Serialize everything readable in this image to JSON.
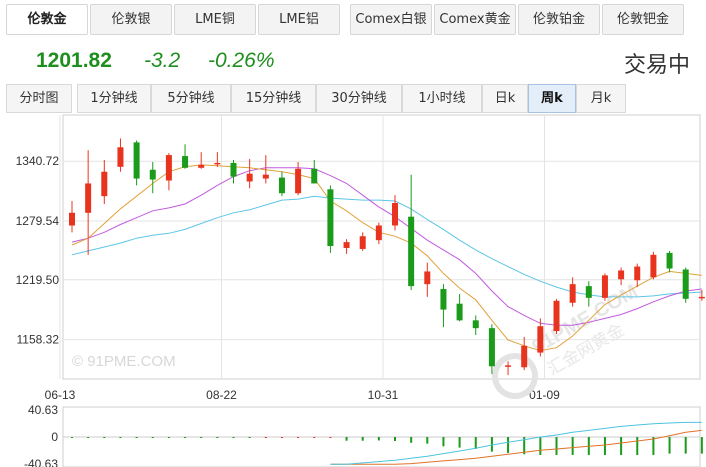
{
  "tabs": [
    {
      "label": "伦敦金",
      "active": true
    },
    {
      "label": "伦敦银",
      "active": false
    },
    {
      "label": "LME铜",
      "active": false
    },
    {
      "label": "LME铝",
      "active": false
    },
    {
      "label": "Comex白银",
      "active": false
    },
    {
      "label": "Comex黄金",
      "active": false
    },
    {
      "label": "伦敦铂金",
      "active": false
    },
    {
      "label": "伦敦钯金",
      "active": false
    }
  ],
  "quote": {
    "price": "1201.82",
    "change": "-3.2",
    "change_pct": "-0.26%",
    "status": "交易中",
    "color": "#1e8f1e"
  },
  "periods": [
    {
      "label": "分时图",
      "active": false
    },
    {
      "label": "1分钟线",
      "active": false
    },
    {
      "label": "5分钟线",
      "active": false
    },
    {
      "label": "15分钟线",
      "active": false
    },
    {
      "label": "30分钟线",
      "active": false
    },
    {
      "label": "1小时线",
      "active": false
    },
    {
      "label": "日k",
      "active": false
    },
    {
      "label": "周k",
      "active": true
    },
    {
      "label": "月k",
      "active": false
    }
  ],
  "watermarks": {
    "left": "© 91PME.COM",
    "right_line1": "91PME.COM",
    "right_line2": "汇金网黄金"
  },
  "colors": {
    "up": "#e8341f",
    "down": "#1a9b1a",
    "ma_short": "#e0a23a",
    "ma_mid": "#c35ae0",
    "ma_long": "#5cc6e6",
    "grid": "#e4e4e4"
  },
  "chart_data": [
    {
      "type": "candlestick",
      "title": "",
      "y_ticks": [
        "1340.72",
        "1279.54",
        "1219.50",
        "1158.32"
      ],
      "y_tick_values": [
        1340.72,
        1279.54,
        1219.5,
        1158.32
      ],
      "ylim": [
        1118,
        1388
      ],
      "x_ticks": [
        "06-13",
        "08-22",
        "10-31",
        "01-09"
      ],
      "x_tick_index": [
        0,
        10,
        20,
        30
      ],
      "grid": true,
      "candles": [
        {
          "o": 1275,
          "h": 1300,
          "l": 1268,
          "c": 1288
        },
        {
          "o": 1288,
          "h": 1352,
          "l": 1245,
          "c": 1318
        },
        {
          "o": 1305,
          "h": 1342,
          "l": 1297,
          "c": 1330
        },
        {
          "o": 1335,
          "h": 1364,
          "l": 1330,
          "c": 1355
        },
        {
          "o": 1360,
          "h": 1362,
          "l": 1316,
          "c": 1323
        },
        {
          "o": 1332,
          "h": 1340,
          "l": 1308,
          "c": 1322
        },
        {
          "o": 1321,
          "h": 1349,
          "l": 1311,
          "c": 1347
        },
        {
          "o": 1346,
          "h": 1358,
          "l": 1333,
          "c": 1334
        },
        {
          "o": 1334,
          "h": 1350,
          "l": 1333,
          "c": 1337
        },
        {
          "o": 1338,
          "h": 1350,
          "l": 1335,
          "c": 1339
        },
        {
          "o": 1339,
          "h": 1342,
          "l": 1318,
          "c": 1325
        },
        {
          "o": 1320,
          "h": 1343,
          "l": 1313,
          "c": 1328
        },
        {
          "o": 1323,
          "h": 1347,
          "l": 1318,
          "c": 1327
        },
        {
          "o": 1324,
          "h": 1330,
          "l": 1305,
          "c": 1308
        },
        {
          "o": 1308,
          "h": 1340,
          "l": 1306,
          "c": 1333
        },
        {
          "o": 1333,
          "h": 1342,
          "l": 1318,
          "c": 1318
        },
        {
          "o": 1312,
          "h": 1316,
          "l": 1247,
          "c": 1254
        },
        {
          "o": 1252,
          "h": 1261,
          "l": 1246,
          "c": 1258
        },
        {
          "o": 1251,
          "h": 1268,
          "l": 1249,
          "c": 1264
        },
        {
          "o": 1260,
          "h": 1278,
          "l": 1256,
          "c": 1275
        },
        {
          "o": 1275,
          "h": 1306,
          "l": 1270,
          "c": 1298
        },
        {
          "o": 1284,
          "h": 1327,
          "l": 1209,
          "c": 1213
        },
        {
          "o": 1215,
          "h": 1237,
          "l": 1202,
          "c": 1228
        },
        {
          "o": 1210,
          "h": 1215,
          "l": 1171,
          "c": 1189
        },
        {
          "o": 1195,
          "h": 1205,
          "l": 1177,
          "c": 1178
        },
        {
          "o": 1178,
          "h": 1183,
          "l": 1163,
          "c": 1170
        },
        {
          "o": 1170,
          "h": 1174,
          "l": 1123,
          "c": 1131
        },
        {
          "o": 1131,
          "h": 1136,
          "l": 1122,
          "c": 1132
        },
        {
          "o": 1130,
          "h": 1161,
          "l": 1127,
          "c": 1152
        },
        {
          "o": 1145,
          "h": 1180,
          "l": 1141,
          "c": 1172
        },
        {
          "o": 1167,
          "h": 1200,
          "l": 1164,
          "c": 1198
        },
        {
          "o": 1196,
          "h": 1222,
          "l": 1192,
          "c": 1215
        },
        {
          "o": 1213,
          "h": 1218,
          "l": 1192,
          "c": 1201
        },
        {
          "o": 1201,
          "h": 1226,
          "l": 1198,
          "c": 1224
        },
        {
          "o": 1220,
          "h": 1232,
          "l": 1214,
          "c": 1229
        },
        {
          "o": 1219,
          "h": 1236,
          "l": 1212,
          "c": 1233
        },
        {
          "o": 1222,
          "h": 1248,
          "l": 1220,
          "c": 1245
        },
        {
          "o": 1247,
          "h": 1249,
          "l": 1227,
          "c": 1231
        },
        {
          "o": 1230,
          "h": 1232,
          "l": 1196,
          "c": 1200
        },
        {
          "o": 1201,
          "h": 1209,
          "l": 1198,
          "c": 1202
        }
      ],
      "ma_short": [
        1255,
        1262,
        1277,
        1292,
        1305,
        1318,
        1330,
        1335,
        1337,
        1336,
        1335,
        1334,
        1332,
        1330,
        1327,
        1323,
        1300,
        1290,
        1278,
        1268,
        1264,
        1257,
        1244,
        1226,
        1211,
        1199,
        1178,
        1158,
        1152,
        1147,
        1150,
        1162,
        1178,
        1194,
        1204,
        1213,
        1222,
        1228,
        1226,
        1224
      ],
      "ma_mid": [
        1258,
        1262,
        1268,
        1276,
        1283,
        1290,
        1293,
        1297,
        1306,
        1316,
        1325,
        1331,
        1334,
        1334,
        1334,
        1333,
        1326,
        1318,
        1306,
        1294,
        1284,
        1272,
        1260,
        1250,
        1240,
        1226,
        1208,
        1192,
        1183,
        1175,
        1173,
        1173,
        1176,
        1180,
        1184,
        1190,
        1197,
        1203,
        1208,
        1210
      ],
      "ma_long": [
        1245,
        1249,
        1253,
        1257,
        1262,
        1265,
        1267,
        1271,
        1277,
        1283,
        1288,
        1291,
        1296,
        1301,
        1302,
        1305,
        1303,
        1302,
        1301,
        1301,
        1300,
        1292,
        1281,
        1271,
        1260,
        1250,
        1241,
        1233,
        1225,
        1218,
        1212,
        1207,
        1204,
        1202,
        1202,
        1202,
        1203,
        1205,
        1206,
        1207
      ]
    },
    {
      "type": "bar",
      "title": "",
      "y_ticks": [
        "40.63",
        "0",
        "-40.63"
      ],
      "y_tick_values": [
        40.63,
        0,
        -40.63
      ],
      "ylim": [
        -40.63,
        40.63
      ],
      "histogram": [
        -1.5,
        -1.5,
        -1.5,
        -1.5,
        -1.5,
        -1.5,
        -1.5,
        -1.5,
        -1.5,
        -1.5,
        -1.5,
        -1.5,
        -1.5,
        -1.5,
        -1.5,
        -1.5,
        -1.5,
        -5.6,
        -5.6,
        -5.2,
        -6.0,
        -8.7,
        -10,
        -14,
        -16,
        -18,
        -22,
        -24,
        -26,
        -27,
        -27,
        -27,
        -27,
        -27,
        -27,
        -27,
        -27,
        -25,
        -25,
        -25
      ],
      "line_a": [
        null,
        null,
        null,
        null,
        null,
        null,
        null,
        null,
        null,
        null,
        null,
        null,
        null,
        null,
        null,
        null,
        -41,
        -41,
        -39,
        -37,
        -35,
        -32,
        -29,
        -25,
        -21,
        -17,
        -12,
        -8,
        -4,
        0,
        3,
        7,
        10,
        13,
        16,
        18,
        20,
        21,
        22,
        22
      ],
      "line_b": [
        null,
        null,
        null,
        null,
        null,
        null,
        null,
        null,
        null,
        null,
        null,
        null,
        null,
        null,
        null,
        null,
        -41,
        -41,
        -41,
        -41,
        -41,
        -40,
        -38,
        -36,
        -34,
        -32,
        -29,
        -26,
        -23,
        -20,
        -18,
        -16,
        -14,
        -12,
        -9,
        -6,
        -3,
        2,
        7,
        10
      ]
    }
  ]
}
